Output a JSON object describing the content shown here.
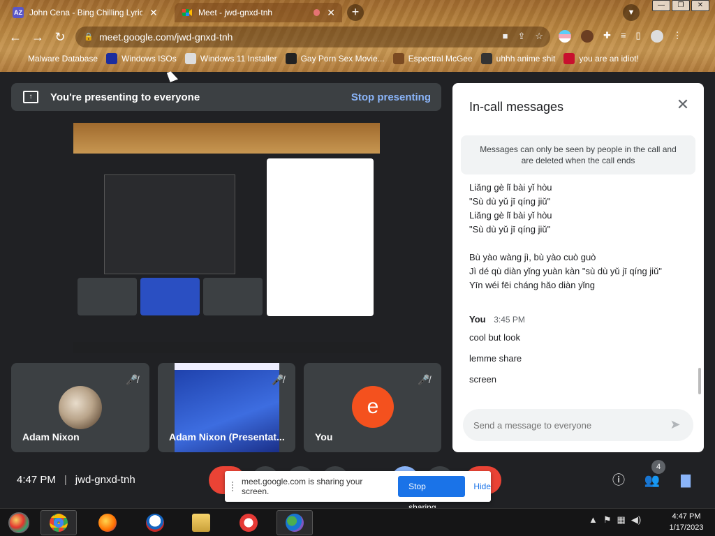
{
  "browser": {
    "tabs": [
      {
        "title": "John Cena - Bing Chilling Lyrics |",
        "favicon": "AZ"
      },
      {
        "title": "Meet - jwd-gnxd-tnh",
        "favicon": ""
      }
    ],
    "url": "meet.google.com/jwd-gnxd-tnh",
    "bookmarks": [
      "Malware Database",
      "Windows ISOs",
      "Windows 11 Installer",
      "Gay Porn Sex Movie...",
      "Espectral McGee",
      "uhhh anime shit",
      "you are an idiot!"
    ]
  },
  "meet": {
    "presenting_text": "You're presenting to everyone",
    "stop_presenting": "Stop presenting",
    "tiles": [
      {
        "name": "Adam Nixon"
      },
      {
        "name": "Adam Nixon (Presentat..."
      },
      {
        "name": "You",
        "initial": "e"
      }
    ],
    "time": "4:47 PM",
    "meeting_code": "jwd-gnxd-tnh",
    "participants_count": "4",
    "share_banner": {
      "text": "meet.google.com is sharing your screen.",
      "stop": "Stop sharing",
      "hide": "Hide"
    }
  },
  "chat": {
    "title": "In-call messages",
    "notice": "Messages can only be seen by people in the call and are deleted when the call ends",
    "lyrics": [
      "Liǎng gè lǐ bài yǐ hòu",
      "\"Sù dù yǔ jī qíng jiǔ\"",
      "Liǎng gè lǐ bài yǐ hòu",
      "\"Sù dù yǔ jī qíng jiǔ\"",
      "",
      "Bù yào wàng jì, bù yào cuò guò",
      "Jì dé qù diàn yǐng yuàn kàn \"sù dù yǔ jī qíng jiǔ\"",
      "Yīn wéi fēi cháng hǎo diàn yǐng"
    ],
    "sender": "You",
    "sent_time": "3:45 PM",
    "messages": [
      "cool but look",
      "lemme share",
      "screen"
    ],
    "input_placeholder": "Send a message to everyone"
  },
  "taskbar": {
    "time": "4:47 PM",
    "date": "1/17/2023"
  }
}
